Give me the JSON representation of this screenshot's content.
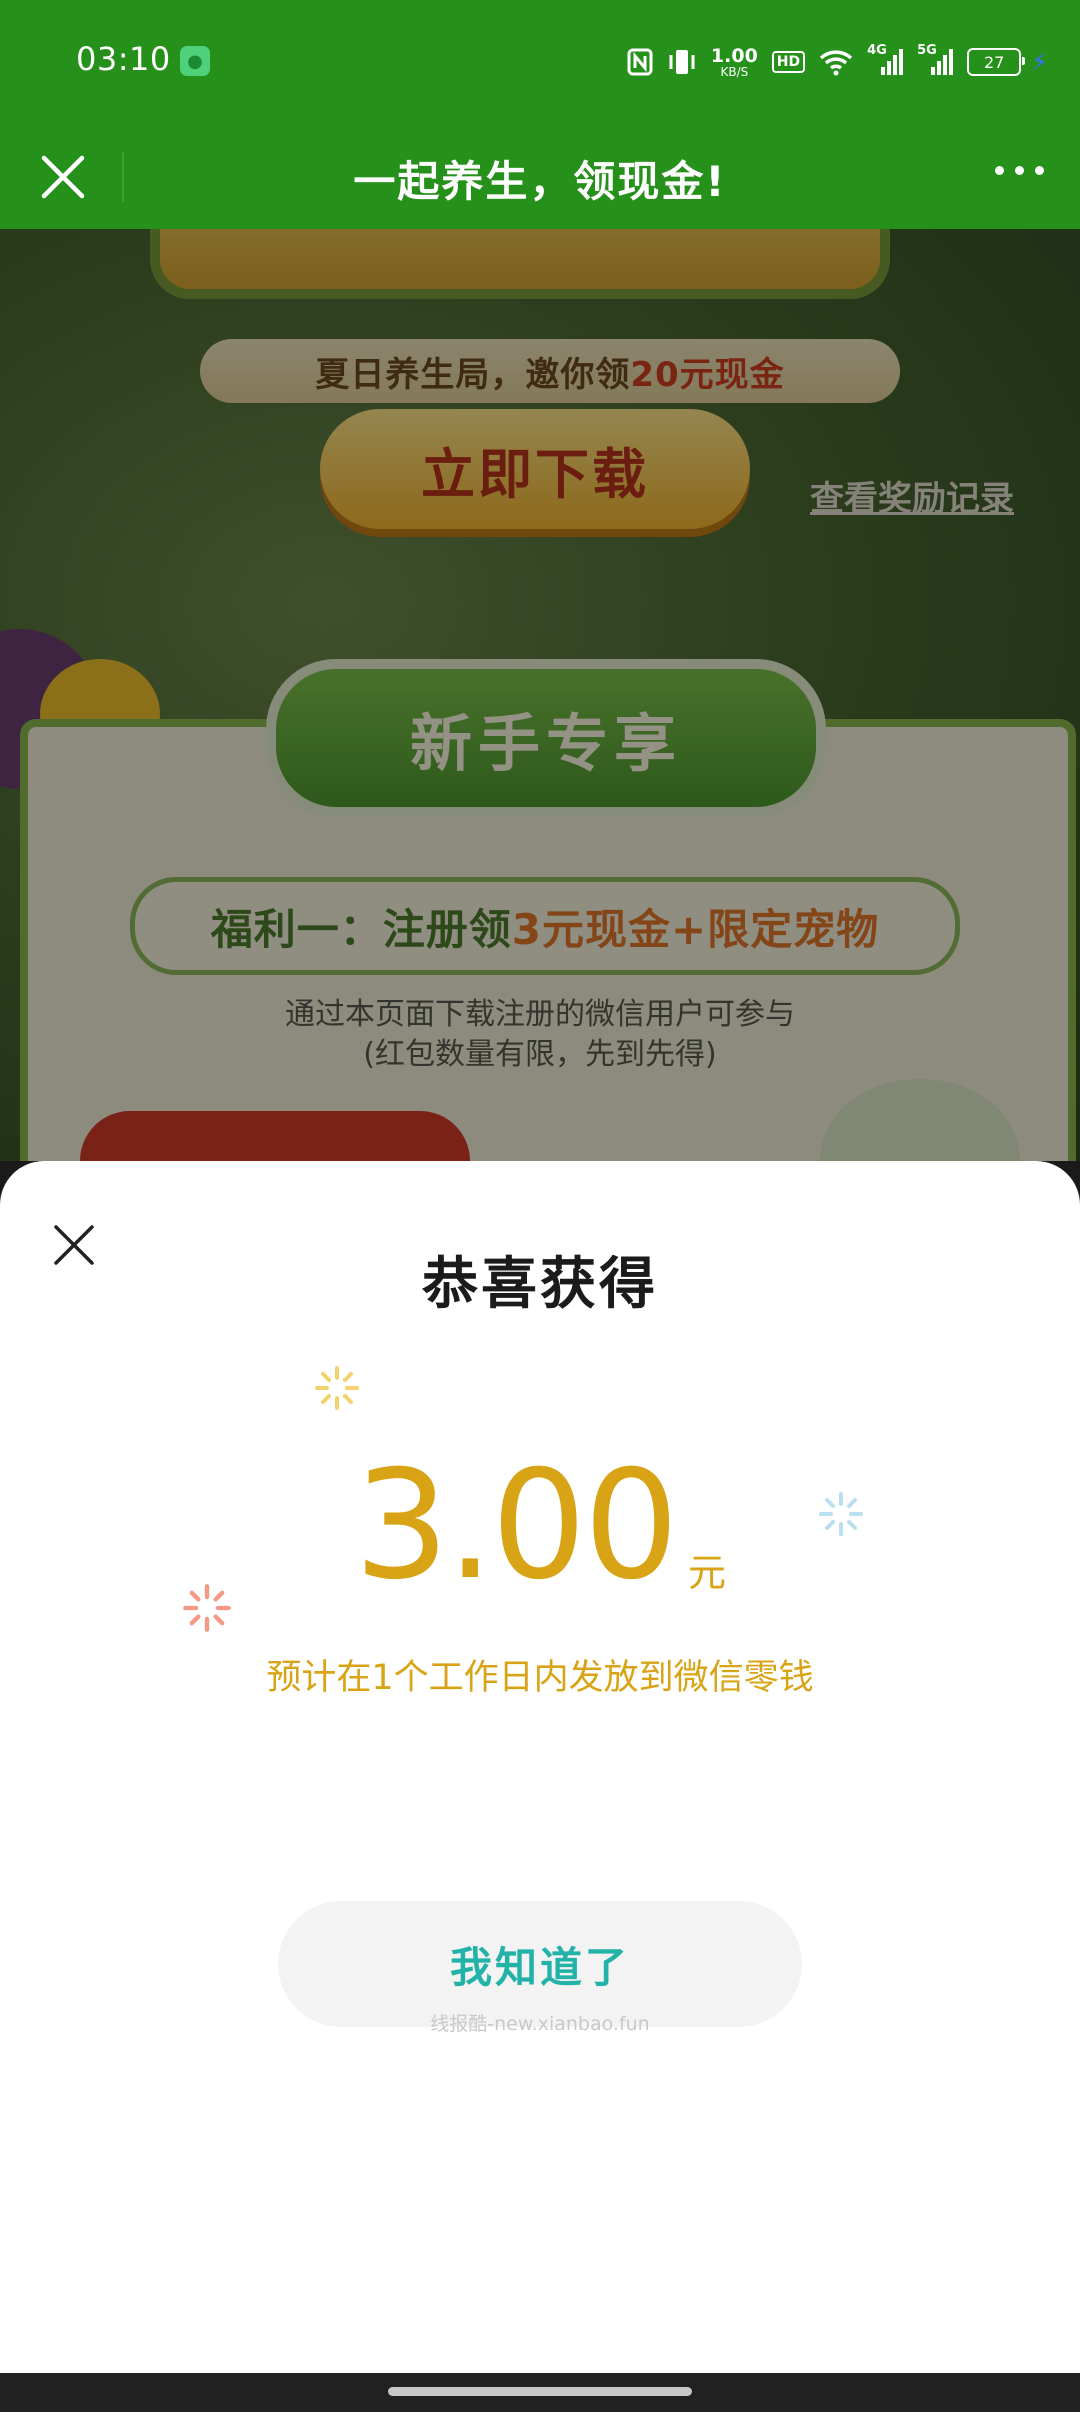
{
  "status_bar": {
    "time": "03:10",
    "net_speed_value": "1.00",
    "net_speed_unit": "KB/S",
    "hd_label": "HD",
    "signal1_type": "4G",
    "signal2_type": "5G",
    "battery": "27",
    "icons": [
      "wechat-app-icon",
      "nfc-icon",
      "vibrate-icon",
      "wifi-icon",
      "signal-icon",
      "battery-icon",
      "charging-icon"
    ]
  },
  "nav": {
    "title": "一起养生，领现金!",
    "close_icon": "close-icon",
    "more_icon": "more-icon"
  },
  "background_page": {
    "subtitle_prefix": "夏日养生局，邀你领",
    "subtitle_highlight": "20元现金",
    "download_button": "立即下载",
    "record_link": "查看奖励记录",
    "badge": "新手专享",
    "benefit_prefix": "福利一：注册领",
    "benefit_highlight": "3元现金+限定宠物",
    "desc_line1": "通过本页面下载注册的微信用户可参与",
    "desc_line2": "(红包数量有限，先到先得)"
  },
  "sheet": {
    "title": "恭喜获得",
    "amount": "3.00",
    "unit": "元",
    "note": "预计在1个工作日内发放到微信零钱",
    "ok_button": "我知道了",
    "watermark": "线报酷-new.xianbao.fun"
  },
  "colors": {
    "nav_green": "#25901a",
    "amount_gold": "#d8a416",
    "button_teal": "#23b2a7"
  }
}
